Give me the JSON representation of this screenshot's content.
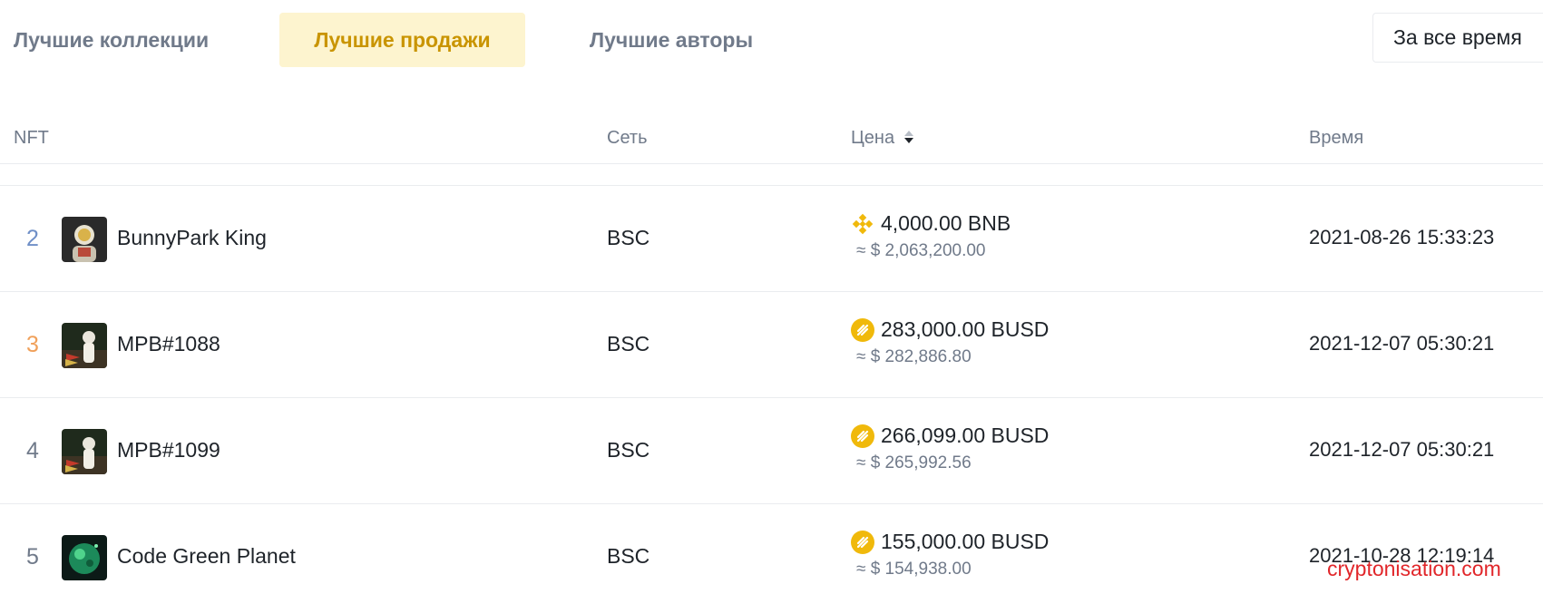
{
  "tabs": [
    {
      "label": "Лучшие коллекции"
    },
    {
      "label": "Лучшие продажи"
    },
    {
      "label": "Лучшие авторы"
    }
  ],
  "period": {
    "label": "За все время"
  },
  "table": {
    "headers": {
      "nft": "NFT",
      "network": "Сеть",
      "price": "Цена",
      "time": "Время"
    },
    "rows": [
      {
        "rank": "2",
        "name": "BunnyPark King",
        "network": "BSC",
        "coin": "bnb-icon",
        "price": "4,000.00 BNB",
        "usd": "≈ $ 2,063,200.00",
        "time": "2021-08-26 15:33:23"
      },
      {
        "rank": "3",
        "name": "MPB#1088",
        "network": "BSC",
        "coin": "busd-icon",
        "price": "283,000.00 BUSD",
        "usd": "≈ $ 282,886.80",
        "time": "2021-12-07 05:30:21"
      },
      {
        "rank": "4",
        "name": "MPB#1099",
        "network": "BSC",
        "coin": "busd-icon",
        "price": "266,099.00 BUSD",
        "usd": "≈ $ 265,992.56",
        "time": "2021-12-07 05:30:21"
      },
      {
        "rank": "5",
        "name": "Code Green Planet",
        "network": "BSC",
        "coin": "busd-icon",
        "price": "155,000.00 BUSD",
        "usd": "≈ $ 154,938.00",
        "time": "2021-10-28 12:19:14"
      }
    ]
  },
  "watermark": "cryptonisation.com",
  "colors": {
    "accent": "#f0b90b",
    "tab_active_bg": "#fdf4cf",
    "tab_active_text": "#c99400",
    "muted": "#707a8a",
    "rank2": "#6f8fc7",
    "rank3": "#f0a05a"
  }
}
